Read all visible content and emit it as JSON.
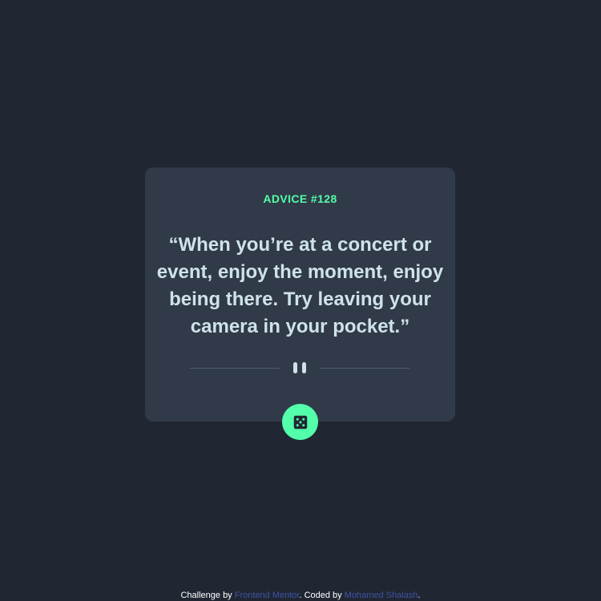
{
  "advice": {
    "label": "ADVICE #128",
    "text": "“When you’re at a concert or event, enjoy the moment, enjoy being there. Try leaving your camera in your pocket.”"
  },
  "generator": {
    "icon": "dice-icon"
  },
  "footer": {
    "prefix": "Challenge by ",
    "challenge_link": "Frontend Mentor",
    "middle": ". Coded by ",
    "author_link": "Mohamed Shalash",
    "suffix": "."
  },
  "colors": {
    "background": "#202733",
    "card": "#313a48",
    "accent": "#53ffaa",
    "text": "#cee3e9",
    "divider": "#4f5d74",
    "link": "#3e52a3"
  }
}
